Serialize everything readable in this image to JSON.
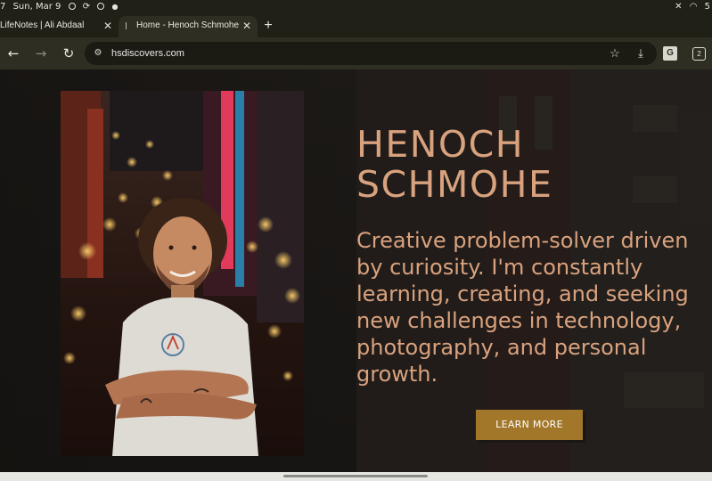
{
  "status_bar": {
    "time_partial": "7",
    "date": "Sun, Mar 9",
    "battery_partial": "5"
  },
  "tabs": [
    {
      "title": "LifeNotes | Ali Abdaal",
      "close": "✕",
      "active": false
    },
    {
      "title": "Home - Henoch Schmohe",
      "close": "✕",
      "active": true
    }
  ],
  "new_tab_icon": "+",
  "toolbar": {
    "url": "hsdiscovers.com",
    "tab_count": "2"
  },
  "icons": {
    "back": "back-arrow-icon",
    "forward": "forward-arrow-icon",
    "reload": "reload-icon",
    "site_info": "tune-icon",
    "bookmark": "star-icon",
    "download": "download-icon",
    "translate": "translate-icon",
    "tabs": "tab-switcher-icon"
  },
  "hero": {
    "name_line1": "HENOCH",
    "name_line2": "SCHMOHE",
    "tagline": "Creative problem-solver driven by curiosity. I'm constantly learning, creating, and seeking new challenges in technology, photography, and personal growth.",
    "cta_label": "LEARN MORE"
  },
  "colors": {
    "accent_text": "#d9a27e",
    "cta_background": "#a2772a",
    "browser_chrome": "#2e2e22"
  }
}
